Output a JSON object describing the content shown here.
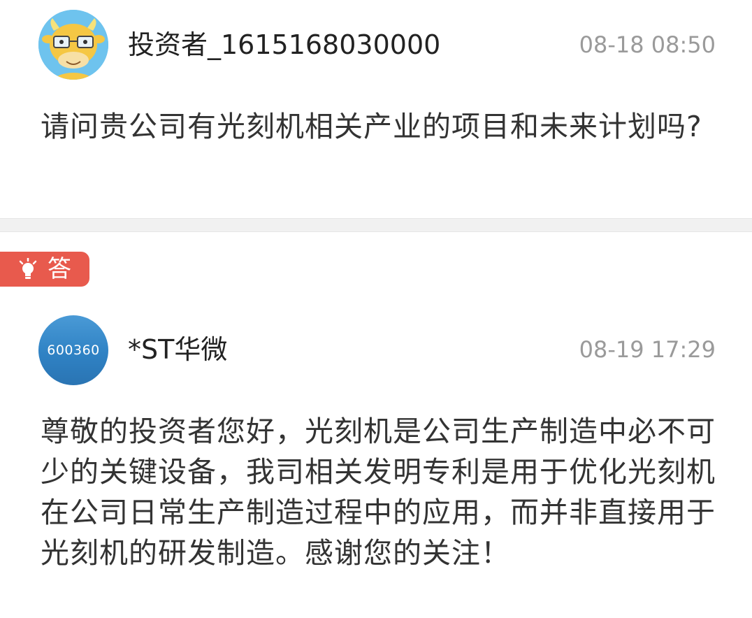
{
  "question": {
    "username": "投资者_1615168030000",
    "time": "08-18 08:50",
    "text": "请问贵公司有光刻机相关产业的项目和未来计划吗?"
  },
  "answer": {
    "badge_label": "答",
    "avatar_code": "600360",
    "company": "*ST华微",
    "time": "08-19 17:29",
    "text": "尊敬的投资者您好，光刻机是公司生产制造中必不可少的关键设备，我司相关发明专利是用于优化光刻机在公司日常生产制造过程中的应用，而并非直接用于光刻机的研发制造。感谢您的关注！"
  },
  "icons": {
    "question_avatar": "cartoon-cow-avatar-icon",
    "answer_badge": "lightbulb-icon"
  },
  "colors": {
    "badge_bg": "#e85a4d",
    "avatar_blue": "#2f82c4",
    "time_gray": "#9a9a9a"
  }
}
